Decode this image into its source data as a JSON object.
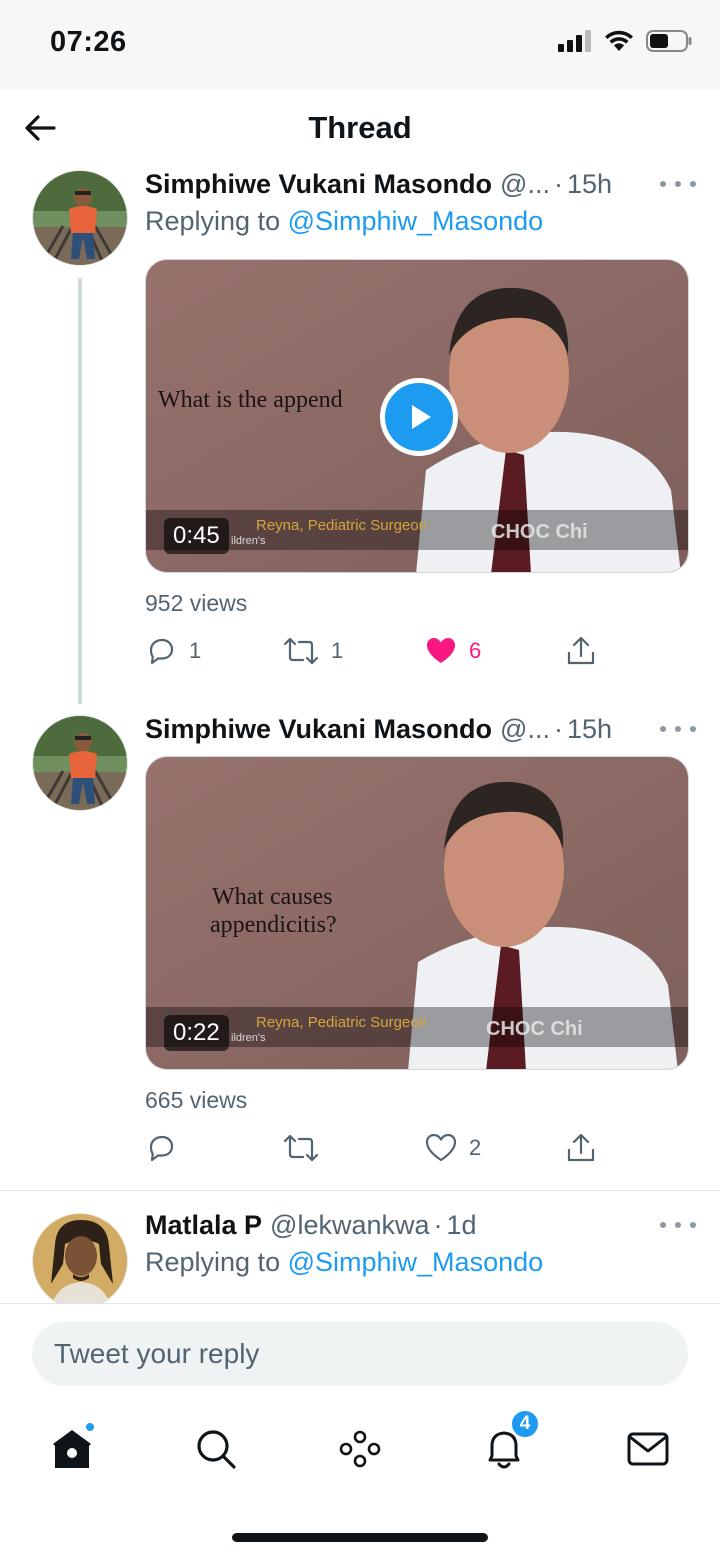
{
  "status_bar": {
    "time": "07:26"
  },
  "header": {
    "title": "Thread"
  },
  "tweets": [
    {
      "name": "Simphiwe Vukani Masondo",
      "handle": "@...",
      "time": "15h",
      "replying_prefix": "Replying to",
      "replying_to": "@Simphiw_Masondo",
      "video": {
        "caption": "What is the append",
        "lower_third": "Reyna, Pediatric Surgeon",
        "lower_third_sub": "ildren's",
        "brand": "CHOC Chi",
        "duration": "0:45"
      },
      "views": "952 views",
      "replies": "1",
      "retweets": "1",
      "likes": "6",
      "liked": true
    },
    {
      "name": "Simphiwe Vukani Masondo",
      "handle": "@...",
      "time": "15h",
      "video": {
        "caption_line1": "What causes",
        "caption_line2": "appendicitis?",
        "lower_third": "Reyna, Pediatric Surgeon",
        "lower_third_sub": "ildren's",
        "brand": "CHOC Chi",
        "duration": "0:22"
      },
      "views": "665 views",
      "replies": "",
      "retweets": "",
      "likes": "2",
      "liked": false
    },
    {
      "name": "Matlala P",
      "handle": "@lekwankwa",
      "time": "1d",
      "replying_prefix": "Replying to",
      "replying_to": "@Simphiw_Masondo"
    }
  ],
  "composer": {
    "placeholder": "Tweet your reply"
  },
  "nav": {
    "items": [
      "home-icon",
      "search-icon",
      "spaces-icon",
      "notifications-icon",
      "messages-icon"
    ],
    "notifications_badge": "4"
  },
  "colors": {
    "accent": "#1d9bf0",
    "like": "#f91880",
    "muted": "#536471"
  }
}
